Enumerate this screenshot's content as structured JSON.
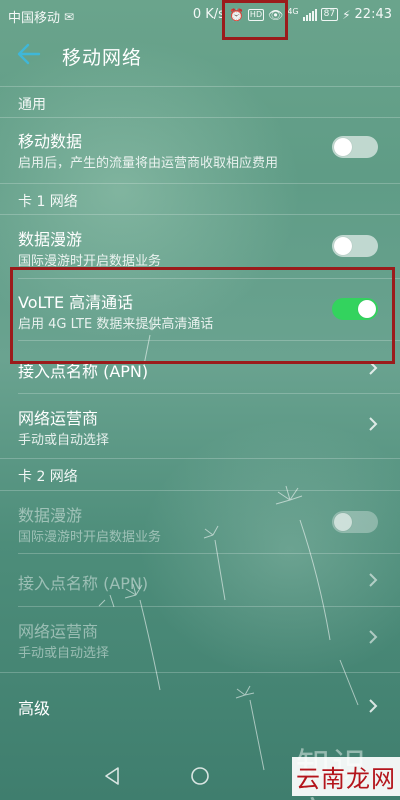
{
  "status_bar": {
    "carrier": "中国移动",
    "speed": "0 K/s",
    "network_type": "4G",
    "battery": "87",
    "time": "22:43"
  },
  "header": {
    "title": "移动网络"
  },
  "sections": {
    "general": {
      "header": "通用",
      "mobile_data": {
        "title": "移动数据",
        "subtitle": "启用后，产生的流量将由运营商收取相应费用",
        "enabled": false
      }
    },
    "sim1": {
      "header": "卡 1 网络",
      "data_roaming": {
        "title": "数据漫游",
        "subtitle": "国际漫游时开启数据业务",
        "enabled": false
      },
      "volte": {
        "title": "VoLTE 高清通话",
        "subtitle": "启用 4G LTE 数据来提供高清通话",
        "enabled": true
      },
      "apn": {
        "title": "接入点名称 (APN)"
      },
      "carrier": {
        "title": "网络运营商",
        "subtitle": "手动或自动选择"
      }
    },
    "sim2": {
      "header": "卡 2 网络",
      "data_roaming": {
        "title": "数据漫游",
        "subtitle": "国际漫游时开启数据业务",
        "enabled": false
      },
      "apn": {
        "title": "接入点名称 (APN)"
      },
      "carrier": {
        "title": "网络运营商",
        "subtitle": "手动或自动选择"
      }
    },
    "advanced": {
      "title": "高级"
    }
  },
  "colors": {
    "toggle_on": "#33d35e",
    "accent_back": "#3fb7d8",
    "annotation": "#9b1b1b"
  },
  "watermark": {
    "faint": "知识家",
    "logo": "云南龙网"
  }
}
